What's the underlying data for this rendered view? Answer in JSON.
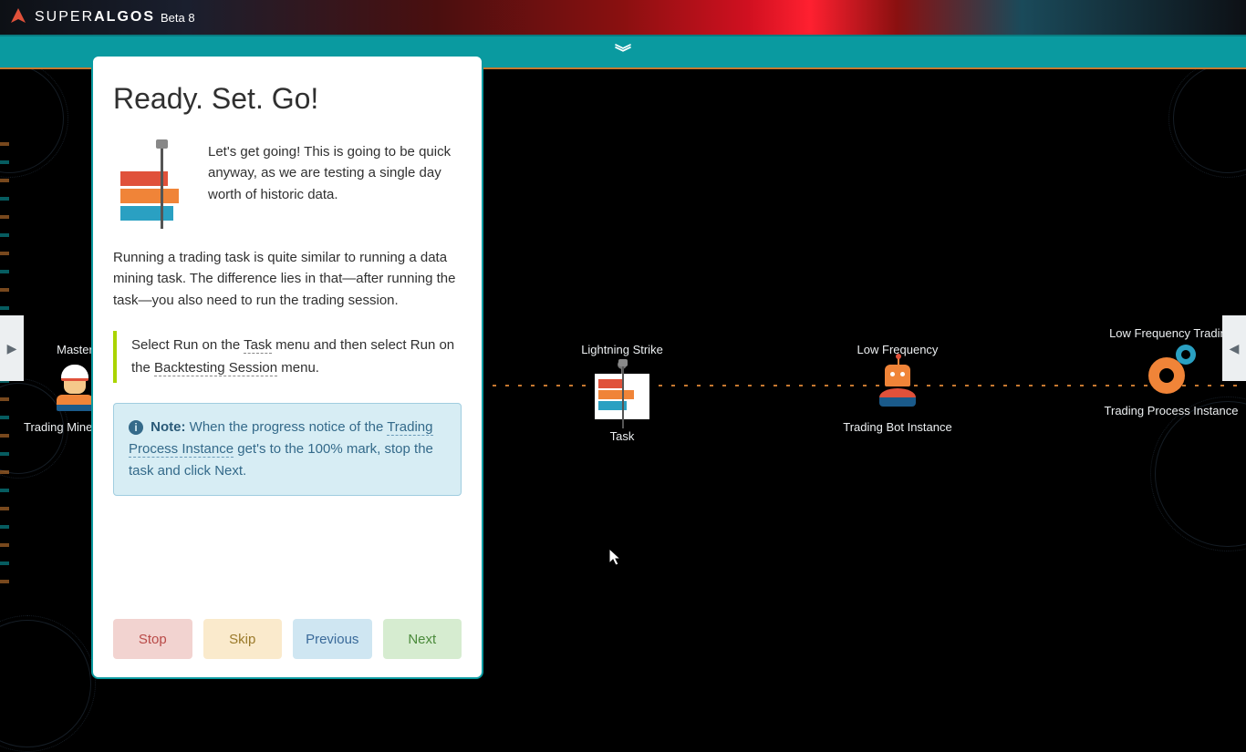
{
  "brand": {
    "name_prefix": "SUPER",
    "name_bold": "ALGOS",
    "sub": "Beta 8"
  },
  "panel": {
    "title": "Ready. Set. Go!",
    "intro": "Let's get going! This is going to be quick anyway, as we are testing a single day worth of historic data.",
    "paragraph": "Running a trading task is quite similar to running a data mining task. The difference lies in that—after running the task—you also need to run the trading session.",
    "callout_pre": "Select Run on the ",
    "callout_link1": "Task",
    "callout_mid": " menu and then select Run on the ",
    "callout_link2": "Backtesting Session",
    "callout_post": " menu.",
    "note_label": "Note:",
    "note_pre": " When the progress notice of the ",
    "note_link": "Trading Process Instance",
    "note_post": " get's to the 100% mark, stop the task and click Next.",
    "buttons": {
      "stop": "Stop",
      "skip": "Skip",
      "prev": "Previous",
      "next": "Next"
    }
  },
  "nodes": {
    "master": {
      "top": "Master",
      "bottom": "Trading Mine Tasks"
    },
    "lightning": {
      "top": "Lightning Strike",
      "bottom": "Task"
    },
    "lowfreq_bot": {
      "top": "Low Frequency",
      "bottom": "Trading Bot Instance"
    },
    "lowfreq_proc": {
      "top": "Low Frequency Trading",
      "bottom": "Trading Process Instance"
    }
  }
}
